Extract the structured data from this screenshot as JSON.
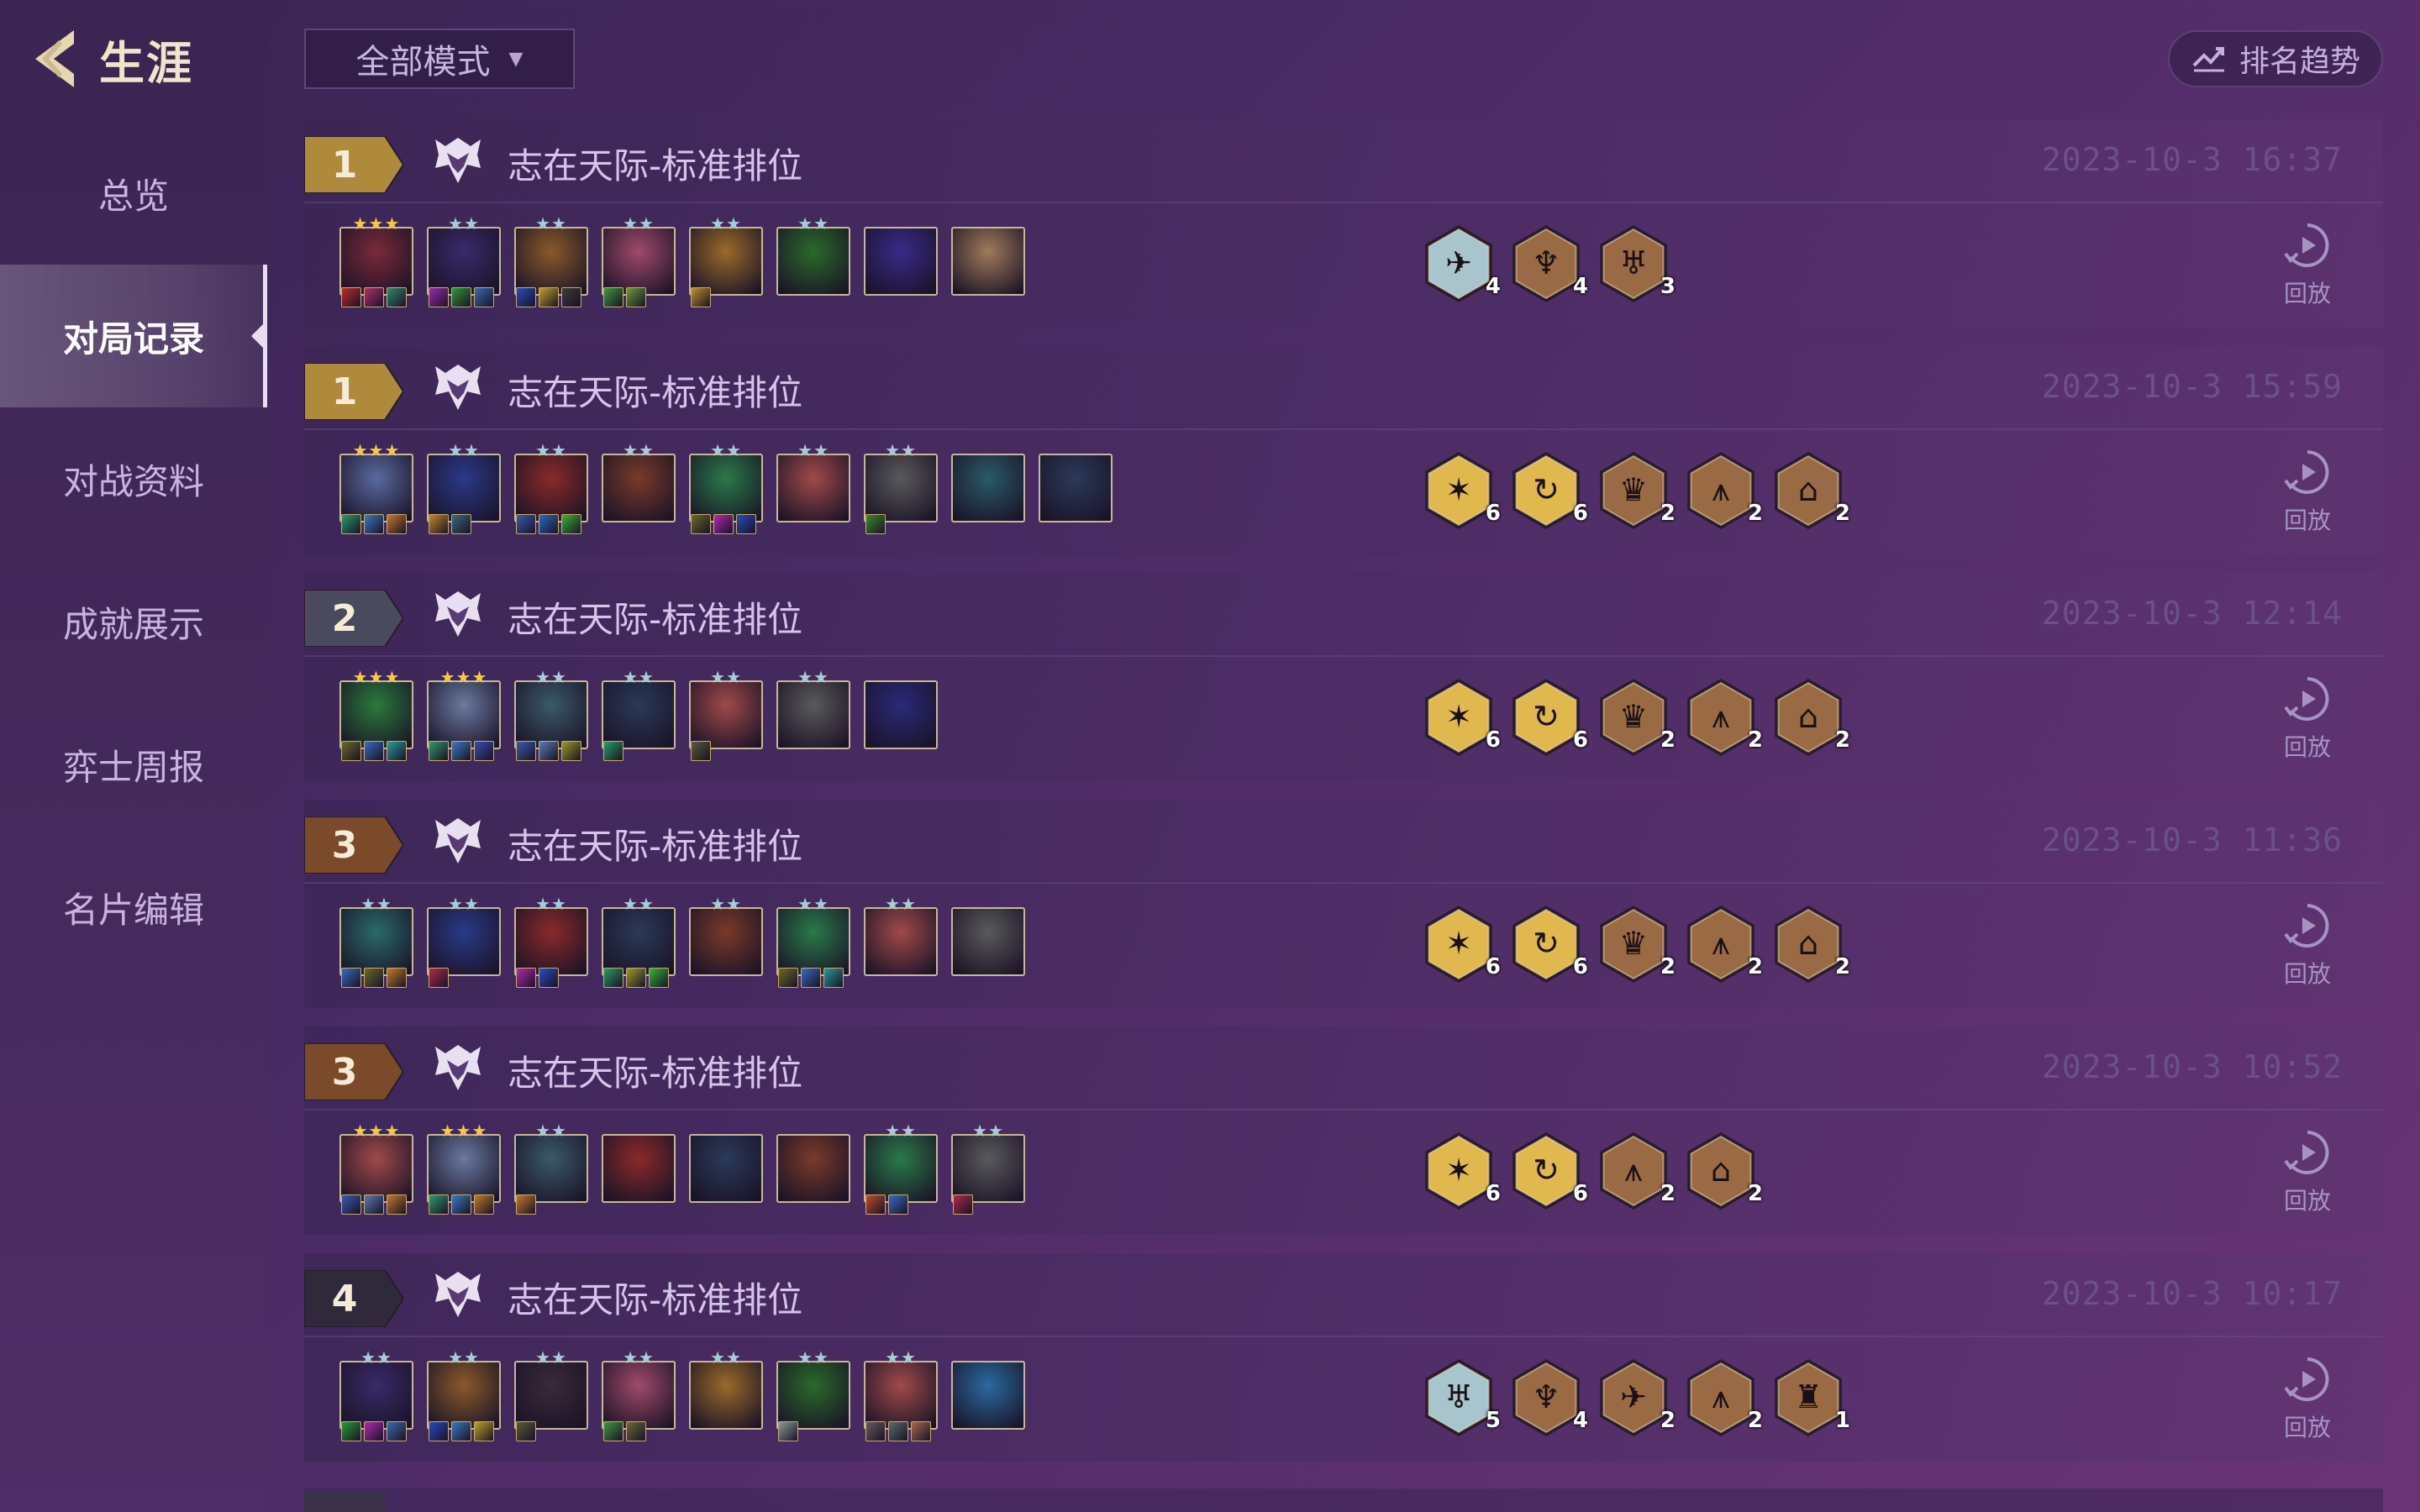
{
  "sidebar": {
    "back_title": "生涯",
    "items": [
      {
        "label": "总览",
        "active": false
      },
      {
        "label": "对局记录",
        "active": true
      },
      {
        "label": "对战资料",
        "active": false
      },
      {
        "label": "成就展示",
        "active": false
      },
      {
        "label": "弈士周报",
        "active": false
      },
      {
        "label": "名片编辑",
        "active": false
      }
    ]
  },
  "toolbar": {
    "mode_filter": "全部模式",
    "trend_label": "排名趋势"
  },
  "replay_label": "回放",
  "colors": {
    "rank_gold": "#b08a3c",
    "rank_silver": "#4a4a5e",
    "rank_bronze": "#7a4a2a",
    "rank_dark": "#2e2a3c",
    "trait_gold": "#e0b84e",
    "trait_bronze": "#9a6a44",
    "trait_silver": "#a8c4cc"
  },
  "matches": [
    {
      "rank": "1",
      "rank_tier": "gold",
      "mode": "志在天际-标准排位",
      "time": "2023-10-3 16:37",
      "champions": [
        {
          "stars": "★★★",
          "star_tier": "gold",
          "color": "#7a2a3a",
          "items": [
            "#c02a2a",
            "#b0306a",
            "#2a8a6a"
          ]
        },
        {
          "stars": "★★",
          "star_tier": "silver",
          "color": "#3a2a6a",
          "items": [
            "#9a2ab0",
            "#2a9a3a",
            "#3a6ab0"
          ]
        },
        {
          "stars": "★★",
          "star_tier": "silver",
          "color": "#8a5a2a",
          "items": [
            "#2a4ac0",
            "#c0a02a",
            "#3a3a3a"
          ]
        },
        {
          "stars": "★★",
          "star_tier": "silver",
          "color": "#a04a6a",
          "items": [
            "#3a9a3a",
            "#6a9a3a"
          ]
        },
        {
          "stars": "★★",
          "star_tier": "silver",
          "color": "#9a6a2a",
          "items": [
            "#c0902a"
          ]
        },
        {
          "stars": "★★",
          "star_tier": "silver",
          "color": "#2a6a2a",
          "items": []
        },
        {
          "stars": "",
          "star_tier": "silver",
          "color": "#3a2a8a",
          "items": []
        },
        {
          "stars": "",
          "star_tier": "silver",
          "color": "#a07a5a",
          "items": []
        }
      ],
      "traits": [
        {
          "tier": "silver",
          "glyph": "✈",
          "count": "4"
        },
        {
          "tier": "bronze",
          "glyph": "♆",
          "count": "4"
        },
        {
          "tier": "bronze",
          "glyph": "♅",
          "count": "3"
        }
      ]
    },
    {
      "rank": "1",
      "rank_tier": "gold",
      "mode": "志在天际-标准排位",
      "time": "2023-10-3 15:59",
      "champions": [
        {
          "stars": "★★★",
          "star_tier": "gold",
          "color": "#5a6aa0",
          "items": [
            "#2a9a6a",
            "#3a7ac0",
            "#c07a2a"
          ]
        },
        {
          "stars": "★★",
          "star_tier": "silver",
          "color": "#2a3a8a",
          "items": [
            "#c08a2a",
            "#3a6a7a"
          ]
        },
        {
          "stars": "★★",
          "star_tier": "silver",
          "color": "#8a2a2a",
          "items": [
            "#3a5ab0",
            "#2a6ac0",
            "#3ab03a"
          ]
        },
        {
          "stars": "★★",
          "star_tier": "silver",
          "color": "#7a3a2a",
          "items": []
        },
        {
          "stars": "★★",
          "star_tier": "silver",
          "color": "#2a7a4a",
          "items": [
            "#6a6a2a",
            "#b02ab0",
            "#2a4ac0"
          ]
        },
        {
          "stars": "★★",
          "star_tier": "silver",
          "color": "#a04a4a",
          "items": []
        },
        {
          "stars": "★★",
          "star_tier": "silver",
          "color": "#5a5a5a",
          "items": [
            "#3a8a2a"
          ]
        },
        {
          "stars": "",
          "star_tier": "silver",
          "color": "#2a5a6a",
          "items": []
        },
        {
          "stars": "",
          "star_tier": "silver",
          "color": "#2a3a5a",
          "items": []
        }
      ],
      "traits": [
        {
          "tier": "gold",
          "glyph": "✶",
          "count": "6"
        },
        {
          "tier": "gold",
          "glyph": "↻",
          "count": "6"
        },
        {
          "tier": "bronze",
          "glyph": "♛",
          "count": "2"
        },
        {
          "tier": "bronze",
          "glyph": "⩚",
          "count": "2"
        },
        {
          "tier": "bronze",
          "glyph": "⌂",
          "count": "2"
        }
      ]
    },
    {
      "rank": "2",
      "rank_tier": "silver",
      "mode": "志在天际-标准排位",
      "time": "2023-10-3 12:14",
      "champions": [
        {
          "stars": "★★★",
          "star_tier": "gold",
          "color": "#2a7a3a",
          "items": [
            "#6a6a2a",
            "#3a6ac0",
            "#2a9a9a"
          ]
        },
        {
          "stars": "★★★",
          "star_tier": "gold",
          "color": "#6a7aa0",
          "items": [
            "#2a9a6a",
            "#3a7ac0",
            "#3a4ab0"
          ]
        },
        {
          "stars": "★★",
          "star_tier": "silver",
          "color": "#3a5a6a",
          "items": [
            "#3a5ab0",
            "#5a7ab0",
            "#9a9a2a"
          ]
        },
        {
          "stars": "★★",
          "star_tier": "silver",
          "color": "#2a3a5a",
          "items": [
            "#2a9a6a"
          ]
        },
        {
          "stars": "★★",
          "star_tier": "silver",
          "color": "#a04a4a",
          "items": [
            "#5a5a3a"
          ]
        },
        {
          "stars": "★★",
          "star_tier": "silver",
          "color": "#5a5a5a",
          "items": []
        },
        {
          "stars": "",
          "star_tier": "silver",
          "color": "#2a2a7a",
          "items": []
        }
      ],
      "traits": [
        {
          "tier": "gold",
          "glyph": "✶",
          "count": "6"
        },
        {
          "tier": "gold",
          "glyph": "↻",
          "count": "6"
        },
        {
          "tier": "bronze",
          "glyph": "♛",
          "count": "2"
        },
        {
          "tier": "bronze",
          "glyph": "⩚",
          "count": "2"
        },
        {
          "tier": "bronze",
          "glyph": "⌂",
          "count": "2"
        }
      ]
    },
    {
      "rank": "3",
      "rank_tier": "bronze",
      "mode": "志在天际-标准排位",
      "time": "2023-10-3 11:36",
      "champions": [
        {
          "stars": "★★",
          "star_tier": "silver",
          "color": "#2a6a6a",
          "items": [
            "#3a6ac0",
            "#6a6a2a",
            "#c07a2a"
          ]
        },
        {
          "stars": "★★",
          "star_tier": "silver",
          "color": "#2a3a8a",
          "items": [
            "#b02a4a"
          ]
        },
        {
          "stars": "★★",
          "star_tier": "silver",
          "color": "#8a2a2a",
          "items": [
            "#b02ab0",
            "#2a4ac0"
          ]
        },
        {
          "stars": "★★",
          "star_tier": "silver",
          "color": "#2a3a5a",
          "items": [
            "#2a9a6a",
            "#9a9a2a",
            "#3ab03a"
          ]
        },
        {
          "stars": "★★",
          "star_tier": "silver",
          "color": "#7a3a2a",
          "items": []
        },
        {
          "stars": "★★",
          "star_tier": "silver",
          "color": "#2a7a4a",
          "items": [
            "#6a6a2a",
            "#3a6ac0",
            "#2a9a9a"
          ]
        },
        {
          "stars": "★★",
          "star_tier": "silver",
          "color": "#a04a4a",
          "items": []
        },
        {
          "stars": "",
          "star_tier": "silver",
          "color": "#5a5a5a",
          "items": []
        }
      ],
      "traits": [
        {
          "tier": "gold",
          "glyph": "✶",
          "count": "6"
        },
        {
          "tier": "gold",
          "glyph": "↻",
          "count": "6"
        },
        {
          "tier": "bronze",
          "glyph": "♛",
          "count": "2"
        },
        {
          "tier": "bronze",
          "glyph": "⩚",
          "count": "2"
        },
        {
          "tier": "bronze",
          "glyph": "⌂",
          "count": "2"
        }
      ]
    },
    {
      "rank": "3",
      "rank_tier": "bronze",
      "mode": "志在天际-标准排位",
      "time": "2023-10-3 10:52",
      "champions": [
        {
          "stars": "★★★",
          "star_tier": "gold",
          "color": "#a04a4a",
          "items": [
            "#3a5ab0",
            "#5a7ab0",
            "#c07a2a"
          ]
        },
        {
          "stars": "★★★",
          "star_tier": "gold",
          "color": "#6a7aa0",
          "items": [
            "#2a9a6a",
            "#3a7ac0",
            "#c07a2a"
          ]
        },
        {
          "stars": "★★",
          "star_tier": "silver",
          "color": "#3a5a6a",
          "items": [
            "#c07a2a"
          ]
        },
        {
          "stars": "",
          "star_tier": "silver",
          "color": "#8a2a2a",
          "items": []
        },
        {
          "stars": "",
          "star_tier": "silver",
          "color": "#2a3a5a",
          "items": []
        },
        {
          "stars": "",
          "star_tier": "silver",
          "color": "#7a3a2a",
          "items": []
        },
        {
          "stars": "★★",
          "star_tier": "silver",
          "color": "#2a7a4a",
          "items": [
            "#c04a2a",
            "#3a6ac0"
          ]
        },
        {
          "stars": "★★",
          "star_tier": "silver",
          "color": "#5a5a5a",
          "items": [
            "#b02a4a"
          ]
        }
      ],
      "traits": [
        {
          "tier": "gold",
          "glyph": "✶",
          "count": "6"
        },
        {
          "tier": "gold",
          "glyph": "↻",
          "count": "6"
        },
        {
          "tier": "bronze",
          "glyph": "⩚",
          "count": "2"
        },
        {
          "tier": "bronze",
          "glyph": "⌂",
          "count": "2"
        }
      ]
    },
    {
      "rank": "4",
      "rank_tier": "dark",
      "mode": "志在天际-标准排位",
      "time": "2023-10-3 10:17",
      "champions": [
        {
          "stars": "★★",
          "star_tier": "silver",
          "color": "#3a2a6a",
          "items": [
            "#2a9a3a",
            "#b02ab0",
            "#3a6ab0"
          ]
        },
        {
          "stars": "★★",
          "star_tier": "silver",
          "color": "#8a5a2a",
          "items": [
            "#2a4ac0",
            "#3a7ac0",
            "#c0a02a"
          ]
        },
        {
          "stars": "★★",
          "star_tier": "silver",
          "color": "#3a2a3a",
          "items": [
            "#5a5a3a"
          ]
        },
        {
          "stars": "★★",
          "star_tier": "silver",
          "color": "#a04a6a",
          "items": [
            "#3a9a3a",
            "#6a6a3a"
          ]
        },
        {
          "stars": "★★",
          "star_tier": "silver",
          "color": "#9a6a2a",
          "items": []
        },
        {
          "stars": "★★",
          "star_tier": "silver",
          "color": "#2a6a2a",
          "items": [
            "#8a9a9a"
          ]
        },
        {
          "stars": "★★",
          "star_tier": "silver",
          "color": "#a04a4a",
          "items": [
            "#6a5a5a",
            "#5a6a6a",
            "#a06a4a"
          ]
        },
        {
          "stars": "",
          "star_tier": "silver",
          "color": "#2a6aa0",
          "items": []
        }
      ],
      "traits": [
        {
          "tier": "silver",
          "glyph": "♅",
          "count": "5"
        },
        {
          "tier": "bronze",
          "glyph": "♆",
          "count": "4"
        },
        {
          "tier": "bronze",
          "glyph": "✈",
          "count": "2"
        },
        {
          "tier": "bronze",
          "glyph": "⩚",
          "count": "2"
        },
        {
          "tier": "bronze",
          "glyph": "♜",
          "count": "1"
        }
      ]
    }
  ]
}
